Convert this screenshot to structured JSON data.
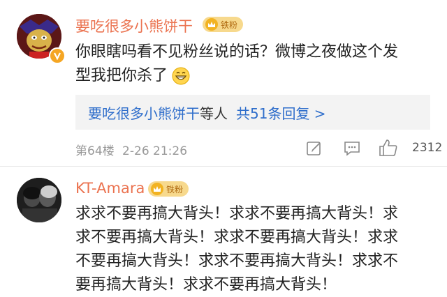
{
  "comments": [
    {
      "username": "要吃很多小熊饼干",
      "fan_badge": "铁粉",
      "body_line1": "你眼瞎吗看不见粉丝说的话？微博之夜做这个发",
      "body_line2": "型我把你杀了",
      "emoji": "grin-emoji",
      "reply_summary": {
        "names": "要吃很多小熊饼干",
        "suffix": "等人",
        "count_text": "共51条回复 >"
      },
      "floor": "第64楼",
      "timestamp": "2-26 21:26",
      "like_count": "2312"
    },
    {
      "username": "KT-Amara",
      "fan_badge": "铁粉",
      "body_lines": [
        "求求不要再搞大背头！求求不要再搞大背头！求",
        "求不要再搞大背头！求求不要再搞大背头！求求",
        "不要再搞大背头！求求不要再搞大背头！求求不",
        "要再搞大背头！求求不要再搞大背头！"
      ]
    }
  ],
  "colors": {
    "username": "#eb7350",
    "link": "#2f6ecb",
    "meta": "#999999",
    "badge_bg": "#f7d98d"
  },
  "icons": {
    "edit": "edit-icon",
    "comment": "comment-icon",
    "like": "thumbs-up-icon",
    "verified": "verified-v-icon",
    "crown": "crown-icon"
  }
}
